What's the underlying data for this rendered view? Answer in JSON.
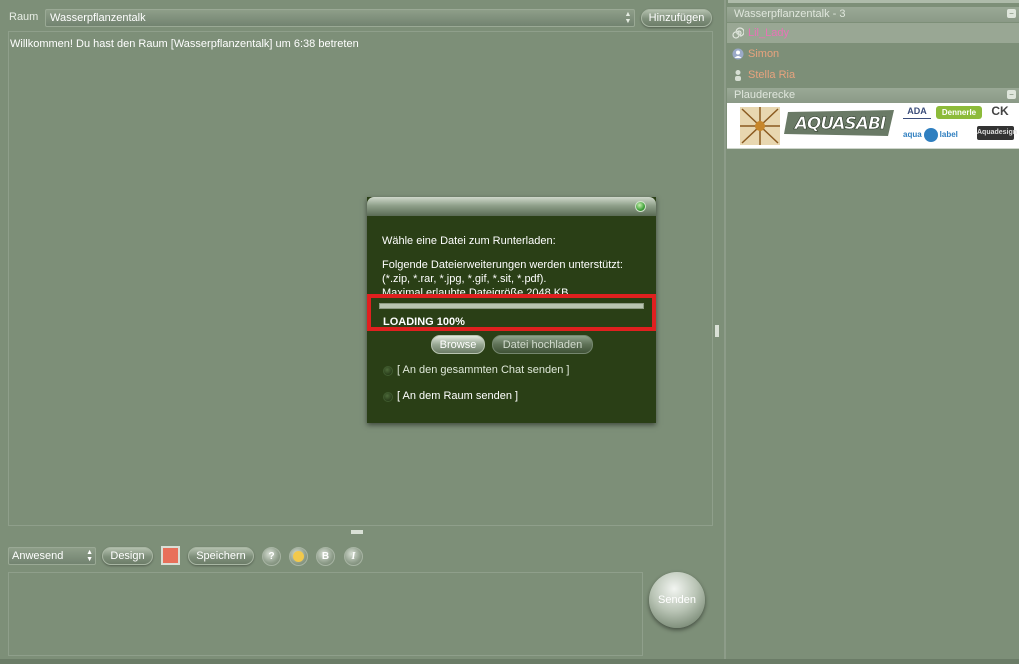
{
  "room": {
    "label": "Raum",
    "selected": "Wasserpflanzentalk",
    "add_label": "Hinzufügen"
  },
  "chat": {
    "welcome": "Willkommen! Du hast den Raum [Wasserpflanzentalk] um 6:38 betreten"
  },
  "toolbar": {
    "status": "Anwesend",
    "design_label": "Design",
    "color": "#e8705a",
    "save_label": "Speichern",
    "help_label": "?",
    "bold_label": "B",
    "italic_label": "I",
    "send_label": "Senden"
  },
  "sidebar": {
    "users_header": "Wasserpflanzentalk - 3",
    "collapse_symbol": "−",
    "users": [
      {
        "name": "Lil_Lady",
        "color": "#e873b6",
        "icon": "spiral-icon"
      },
      {
        "name": "Simon",
        "color": "#e8a37e",
        "icon": "male-user-icon"
      },
      {
        "name": "Stella Ria",
        "color": "#e8a37e",
        "icon": "user-icon"
      }
    ],
    "corner_header": "Plauderecke",
    "sponsors": {
      "main": "AQUASABI",
      "ada": "ADA",
      "dennerle": "Dennerle",
      "ck": "CK",
      "aquaristik": "aqua",
      "aquaristik2": "label",
      "dark": "Aquadesign"
    }
  },
  "dialog": {
    "prompt": "Wähle eine Datei zum Runterladen:",
    "extensions": "Folgende Dateierweiterungen werden unterstützt: (*.zip, *.rar, *.jpg, *.gif, *.sit, *.pdf).",
    "max_size": "Maximal erlaubte Dateigröße 2048 KB",
    "progress": 1.0,
    "loading": "LOADING 100%",
    "browse_label": "Browse",
    "upload_label": "Datei hochladen",
    "option_all": "[ An den gesammten Chat senden ]",
    "option_room": "[ An dem Raum senden ]"
  }
}
